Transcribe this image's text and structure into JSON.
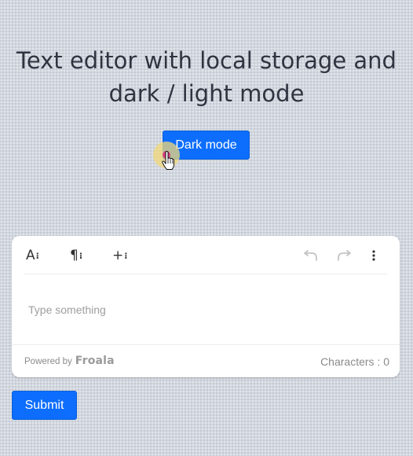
{
  "page": {
    "title": "Text editor with local storage and dark / light mode",
    "mode_button": "Dark mode",
    "submit_button": "Submit"
  },
  "editor": {
    "toolbar": {
      "text_format_glyph": "A",
      "paragraph_format_glyph": "¶",
      "insert_more_glyph": "+",
      "more_dots": "⁝",
      "undo_icon": "undo-icon",
      "redo_icon": "redo-icon",
      "more_menu_icon": "more-vertical-icon"
    },
    "placeholder": "Type something",
    "powered_by_label": "Powered by",
    "brand": "Froala",
    "character_count": "Characters : 0"
  },
  "colors": {
    "accent": "#0d6efd",
    "background": "#d3d8e0",
    "title_text": "#2f3440",
    "editor_bg": "#ffffff",
    "cursor_highlight": "#f2d878",
    "cursor_dot": "#d6427a"
  }
}
